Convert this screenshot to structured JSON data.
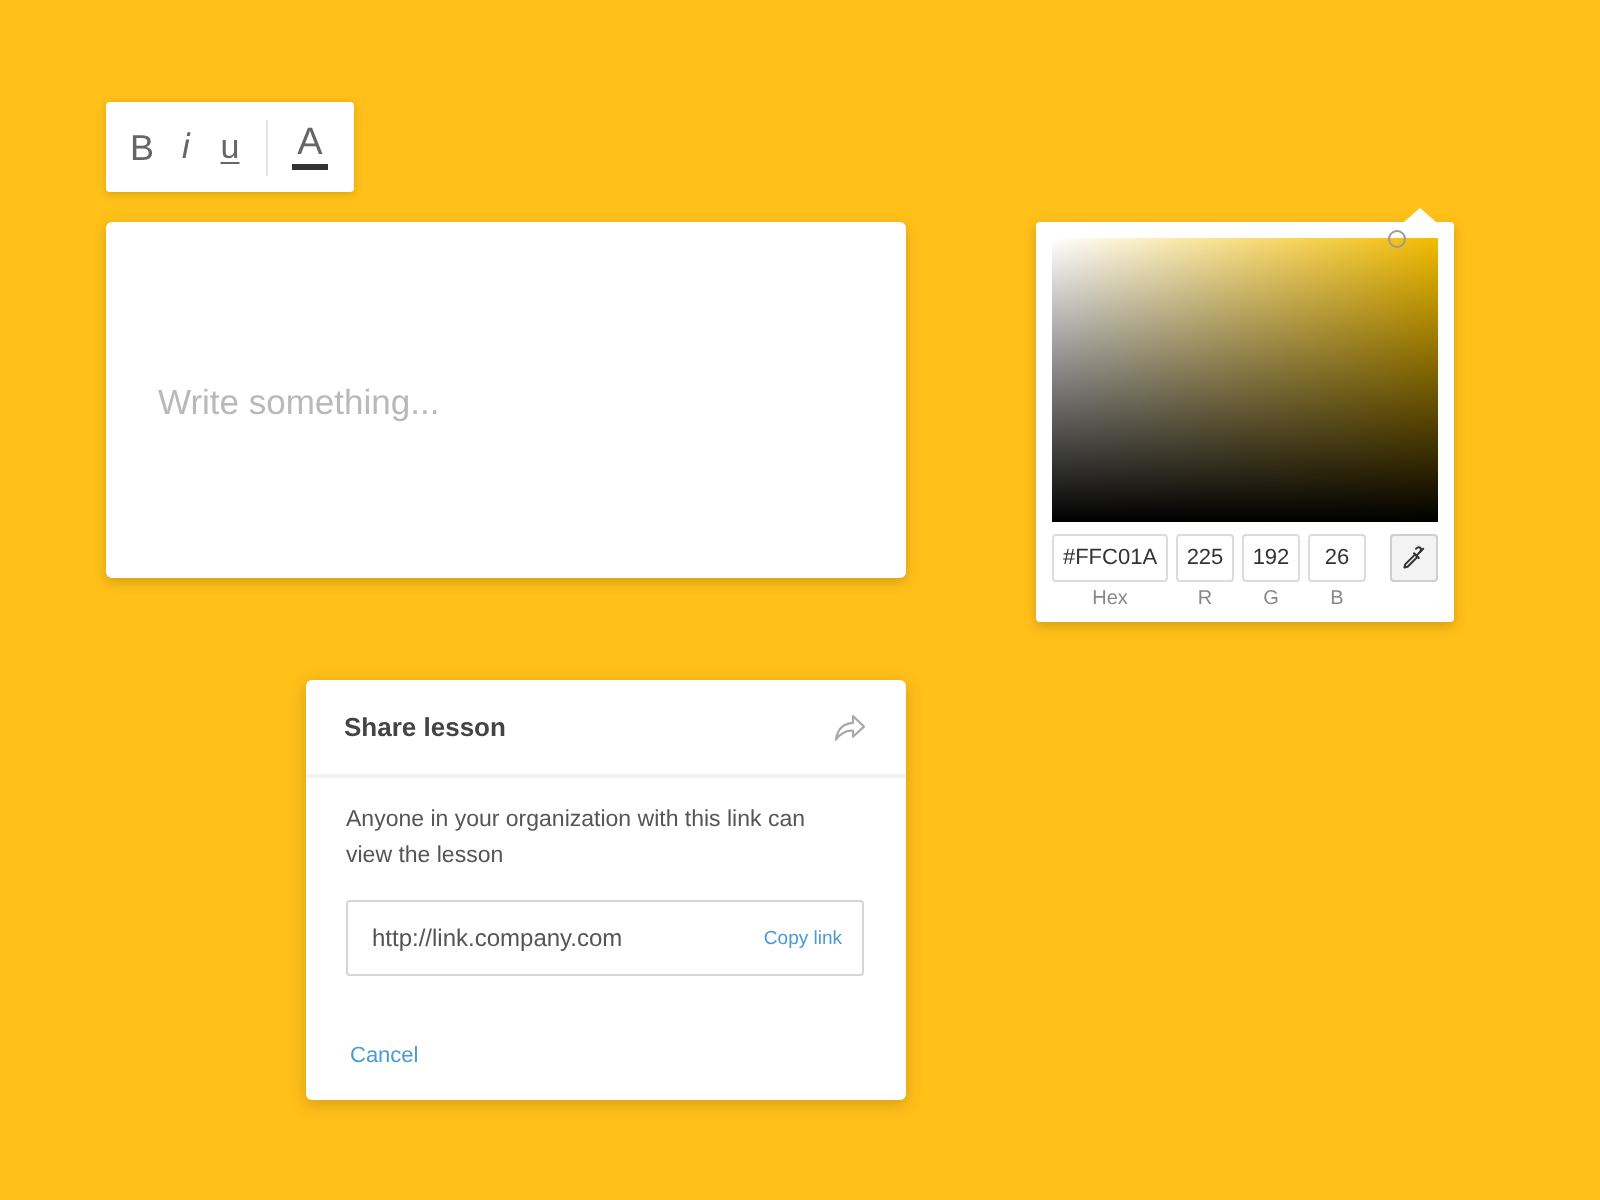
{
  "toolbar": {
    "buttons": [
      {
        "kind": "bold",
        "label": "B"
      },
      {
        "kind": "italic",
        "label": "i"
      },
      {
        "kind": "underline",
        "label": "u"
      },
      {
        "kind": "text_color",
        "label": "A"
      }
    ]
  },
  "editor": {
    "placeholder": "Write something..."
  },
  "color_picker": {
    "fields": [
      {
        "kind": "hex",
        "value": "#FFC01A",
        "label": "Hex"
      },
      {
        "kind": "channel",
        "value": "225",
        "label": "R"
      },
      {
        "kind": "channel",
        "value": "192",
        "label": "G"
      },
      {
        "kind": "channel",
        "value": "26",
        "label": "B"
      }
    ]
  },
  "share_dialog": {
    "title": "Share lesson",
    "description": "Anyone in your organization with this link can view the lesson",
    "link": {
      "value": "http://link.company.com",
      "button": "Copy link"
    },
    "cancel": "Cancel"
  }
}
